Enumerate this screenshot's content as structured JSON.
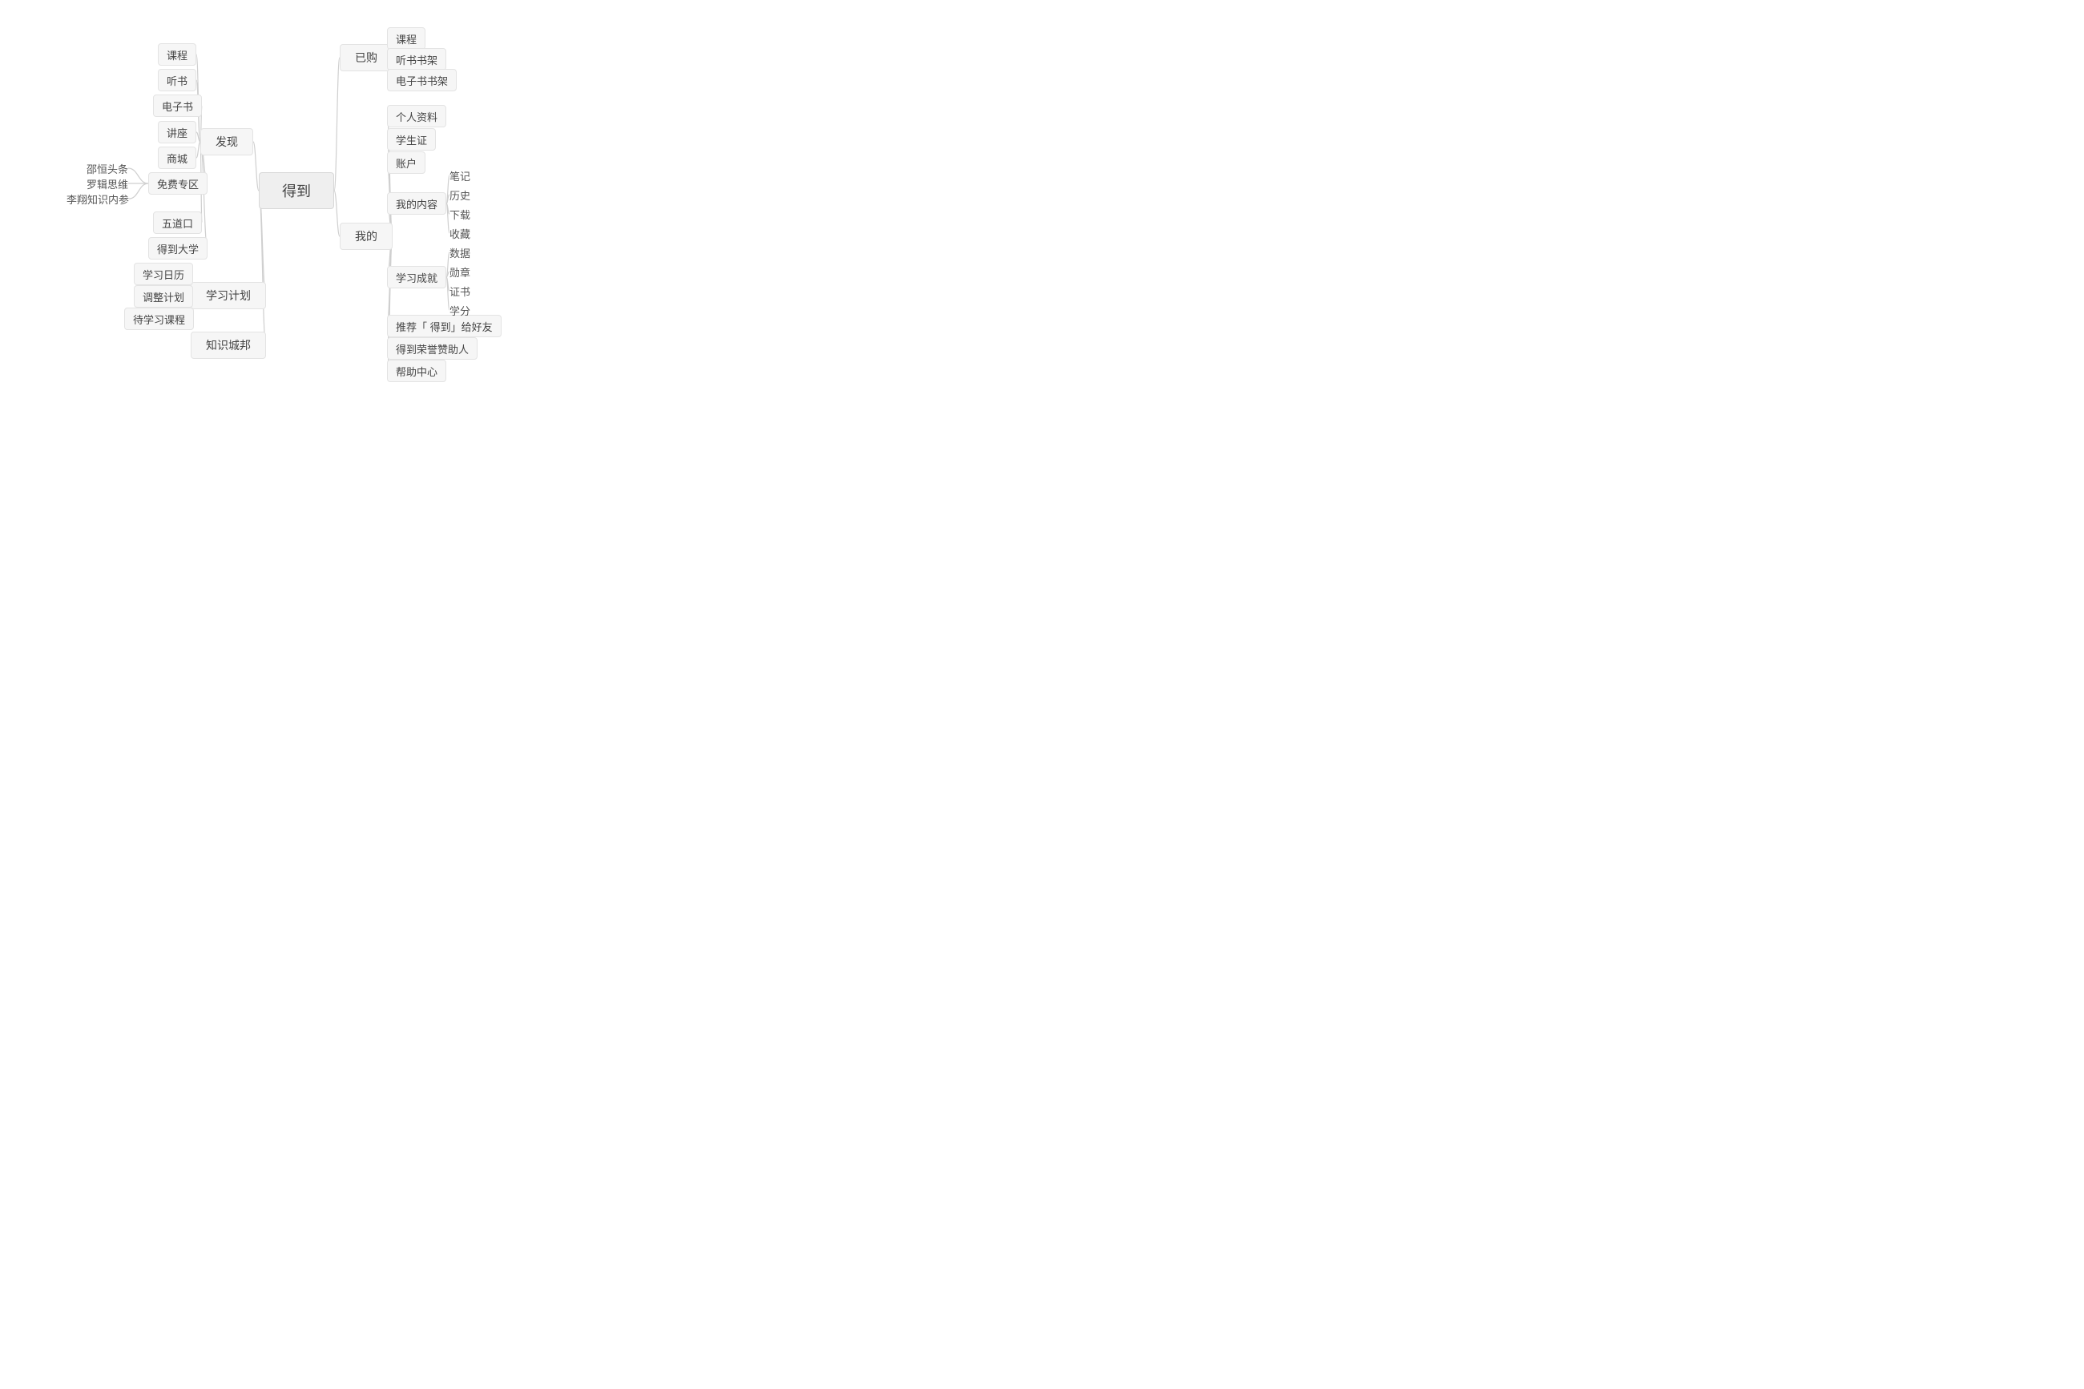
{
  "root": {
    "label": "得到"
  },
  "left": {
    "discover": {
      "label": "发现",
      "children": {
        "course": "课程",
        "listen": "听书",
        "ebook": "电子书",
        "lecture": "讲座",
        "mall": "商城",
        "free_zone": {
          "label": "免费专区",
          "children": {
            "shaoheng": "邵恒头条",
            "luoji": "罗辑思维",
            "lixiang": "李翔知识内参"
          }
        },
        "wudaokou": "五道口",
        "dedao_univ": "得到大学"
      }
    },
    "study_plan": {
      "label": "学习计划",
      "children": {
        "calendar": "学习日历",
        "adjust": "调整计划",
        "pending": "待学习课程"
      }
    },
    "city": {
      "label": "知识城邦"
    }
  },
  "right": {
    "purchased": {
      "label": "已购",
      "children": {
        "course": "课程",
        "listen_shelf": "听书书架",
        "ebook_shelf": "电子书书架"
      }
    },
    "mine": {
      "label": "我的",
      "children": {
        "profile": "个人资料",
        "student_id": "学生证",
        "account": "账户",
        "my_content": {
          "label": "我的内容",
          "children": {
            "notes": "笔记",
            "history": "历史",
            "download": "下载",
            "favorite": "收藏"
          }
        },
        "achievement": {
          "label": "学习成就",
          "children": {
            "data": "数据",
            "medal": "勋章",
            "cert": "证书",
            "credit": "学分"
          }
        },
        "recommend": "推荐「 得到」给好友",
        "sponsor": "得到荣誉赞助人",
        "help": "帮助中心"
      }
    }
  }
}
